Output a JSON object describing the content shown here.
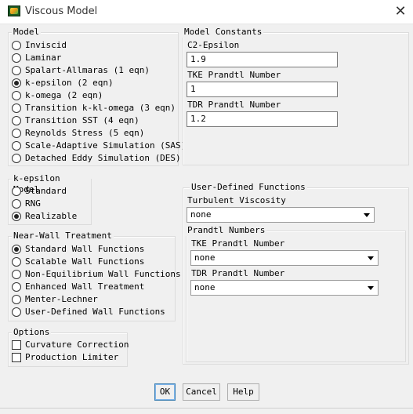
{
  "window": {
    "title": "Viscous Model",
    "icon": "fluent-app-icon",
    "close_icon": "close-icon"
  },
  "model": {
    "title": "Model",
    "options": [
      {
        "label": "Inviscid",
        "selected": false
      },
      {
        "label": "Laminar",
        "selected": false
      },
      {
        "label": "Spalart-Allmaras (1 eqn)",
        "selected": false
      },
      {
        "label": "k-epsilon (2 eqn)",
        "selected": true
      },
      {
        "label": "k-omega (2 eqn)",
        "selected": false
      },
      {
        "label": "Transition k-kl-omega (3 eqn)",
        "selected": false
      },
      {
        "label": "Transition SST (4 eqn)",
        "selected": false
      },
      {
        "label": "Reynolds Stress (5 eqn)",
        "selected": false
      },
      {
        "label": "Scale-Adaptive Simulation (SAS)",
        "selected": false
      },
      {
        "label": "Detached Eddy Simulation (DES)",
        "selected": false
      }
    ]
  },
  "k_epsilon_model": {
    "title": "k-epsilon Model",
    "options": [
      {
        "label": "Standard",
        "selected": false
      },
      {
        "label": "RNG",
        "selected": false
      },
      {
        "label": "Realizable",
        "selected": true
      }
    ]
  },
  "near_wall": {
    "title": "Near-Wall Treatment",
    "options": [
      {
        "label": "Standard Wall Functions",
        "selected": true
      },
      {
        "label": "Scalable Wall Functions",
        "selected": false
      },
      {
        "label": "Non-Equilibrium Wall Functions",
        "selected": false
      },
      {
        "label": "Enhanced Wall Treatment",
        "selected": false
      },
      {
        "label": "Menter-Lechner",
        "selected": false
      },
      {
        "label": "User-Defined Wall Functions",
        "selected": false
      }
    ]
  },
  "options": {
    "title": "Options",
    "items": [
      {
        "label": "Curvature Correction",
        "checked": false
      },
      {
        "label": "Production Limiter",
        "checked": false
      }
    ]
  },
  "model_constants": {
    "title": "Model Constants",
    "fields": [
      {
        "label": "C2-Epsilon",
        "value": "1.9"
      },
      {
        "label": "TKE Prandtl Number",
        "value": "1"
      },
      {
        "label": "TDR Prandtl Number",
        "value": "1.2"
      }
    ]
  },
  "udf": {
    "title": "User-Defined Functions",
    "turbulent_viscosity_label": "Turbulent Viscosity",
    "turbulent_viscosity_value": "none",
    "prandtl_numbers_label": "Prandtl Numbers",
    "tke_label": "TKE Prandtl Number",
    "tke_value": "none",
    "tdr_label": "TDR Prandtl Number",
    "tdr_value": "none"
  },
  "buttons": {
    "ok": "OK",
    "cancel": "Cancel",
    "help": "Help"
  }
}
